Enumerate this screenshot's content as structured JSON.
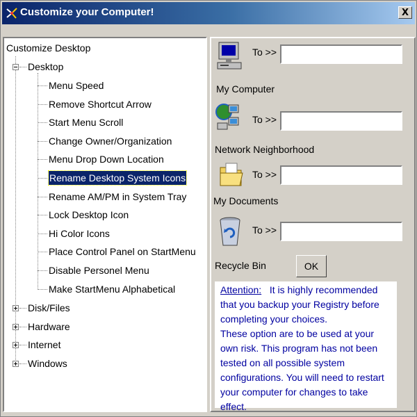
{
  "window": {
    "title": "Customize your Computer!",
    "close_label": "X"
  },
  "tree": {
    "root": "Customize Desktop",
    "desktop": "Desktop",
    "desktop_items": [
      "Menu Speed",
      "Remove Shortcut Arrow",
      "Start Menu Scroll",
      "Change Owner/Organization",
      "Menu Drop Down Location",
      "Rename Desktop System Icons",
      "Rename AM/PM in System Tray",
      "Lock Desktop Icon",
      "Hi Color Icons",
      "Place Control Panel on StartMenu",
      "Disable Personel Menu",
      "Make StartMenu Alphabetical"
    ],
    "selected_item": "Rename Desktop System Icons",
    "collapsed": [
      "Disk/Files",
      "Hardware",
      "Internet",
      "Windows"
    ]
  },
  "rename": {
    "to_label": "To >>",
    "items": [
      {
        "caption": "My Computer",
        "value": "",
        "icon": "my-computer-icon"
      },
      {
        "caption": "Network Neighborhood",
        "value": "",
        "icon": "network-neighborhood-icon"
      },
      {
        "caption": "My Documents",
        "value": "",
        "icon": "my-documents-icon"
      },
      {
        "caption": "Recycle Bin",
        "value": "",
        "icon": "recycle-bin-icon"
      }
    ],
    "ok_label": "OK"
  },
  "attention": {
    "heading": "Attention:",
    "text1": "It is highly recommended that you backup your Registry before completing your choices.",
    "text2": "These option are to be used at your own risk. This program has not been tested on all possible system configurations. You will need to restart your computer for changes to take effect."
  },
  "colors": {
    "title_start": "#0a246a",
    "title_end": "#a6caf0",
    "face": "#d4d0c8",
    "attention_text": "#0000a0"
  }
}
